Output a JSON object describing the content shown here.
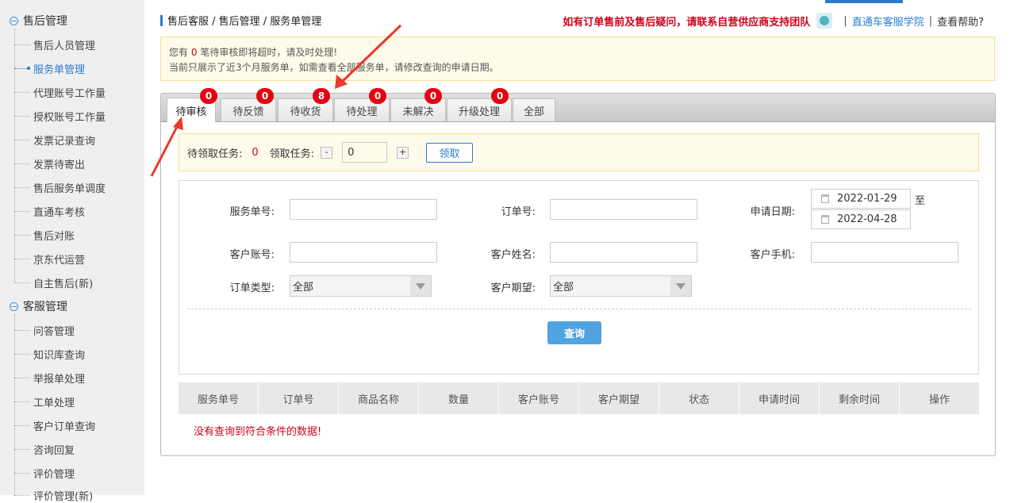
{
  "sidebar": {
    "sections": [
      {
        "title": "售后管理",
        "items": [
          "售后人员管理",
          "服务单管理",
          "代理账号工作量",
          "授权账号工作量",
          "发票记录查询",
          "发票待寄出",
          "售后服务单调度",
          "直通车考核",
          "售后对账",
          "京东代运营",
          "自主售后(新)"
        ]
      },
      {
        "title": "客服管理",
        "items": [
          "问答管理",
          "知识库查询",
          "举报单处理",
          "工单处理",
          "客户订单查询",
          "咨询回复",
          "评价管理",
          "评价管理(新)"
        ]
      }
    ],
    "active_item": "服务单管理"
  },
  "breadcrumb": "售后客服 / 售后管理 / 服务单管理",
  "top_right": {
    "notice": "如有订单售前及售后疑问，请联系自营供应商支持团队",
    "link1": "直通车客服学院",
    "link2": "查看帮助?"
  },
  "notice": {
    "line1_prefix": "您有",
    "count": "0",
    "line1_suffix": "笔待审核即将超时，请及时处理!",
    "line2": "当前只展示了近3个月服务单，如需查看全部服务单，请修改查询的申请日期。"
  },
  "tabs": [
    {
      "label": "待审核",
      "badge": "0"
    },
    {
      "label": "待反馈",
      "badge": "0"
    },
    {
      "label": "待收货",
      "badge": "8"
    },
    {
      "label": "待处理",
      "badge": "0"
    },
    {
      "label": "未解决",
      "badge": "0"
    },
    {
      "label": "升级处理",
      "badge": "0"
    },
    {
      "label": "全部",
      "badge": ""
    }
  ],
  "claim": {
    "pending_label": "待领取任务:",
    "pending_value": "0",
    "claim_label": "领取任务:",
    "minus": "-",
    "plus": "+",
    "quantity": "0",
    "button": "领取"
  },
  "form": {
    "service_no_label": "服务单号:",
    "order_no_label": "订单号:",
    "apply_date_label": "申请日期:",
    "date_from": "2022-01-29",
    "date_to_sep": "至",
    "date_to": "2022-04-28",
    "customer_account_label": "客户账号:",
    "customer_name_label": "客户姓名:",
    "customer_phone_label": "客户手机:",
    "order_type_label": "订单类型:",
    "order_type_value": "全部",
    "customer_expect_label": "客户期望:",
    "customer_expect_value": "全部",
    "search_button": "查询"
  },
  "table": {
    "columns": [
      "服务单号",
      "订单号",
      "商品名称",
      "数量",
      "客户账号",
      "客户期望",
      "状态",
      "申请时间",
      "剩余时间",
      "操作"
    ],
    "empty_message": "没有查询到符合条件的数据!"
  },
  "colors": {
    "accent": "#2b7bd1",
    "alert": "#d0021b",
    "badge": "#e60012",
    "arrow": "#e8392a"
  }
}
